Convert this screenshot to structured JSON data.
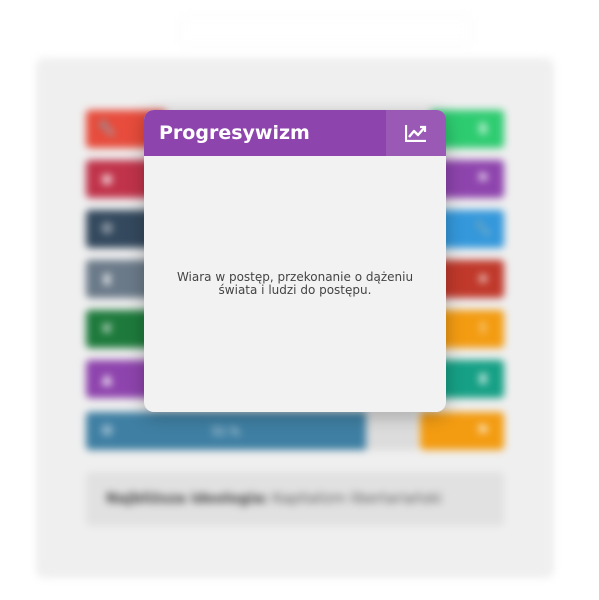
{
  "modal": {
    "title": "Progresywizm",
    "icon": "chart-line-icon",
    "description": "Wiara w postęp, przekonanie o dążeniu świata i ludzi do postępu."
  },
  "background": {
    "left_tiles": [
      {
        "icon": "wrench-icon",
        "color": "#e74c3c"
      },
      {
        "icon": "globe-icon",
        "color": "#c0334a"
      },
      {
        "icon": "gear-icon",
        "color": "#34495e"
      },
      {
        "icon": "document-icon",
        "color": "#6b7a89"
      },
      {
        "icon": "leaf-icon",
        "color": "#1e7a3c"
      },
      {
        "icon": "chart-icon",
        "color": "#8e44ad"
      }
    ],
    "right_tiles": [
      {
        "icon": "dollar-icon",
        "color": "#2ecc71"
      },
      {
        "icon": "flag-icon",
        "color": "#8e44ad"
      },
      {
        "icon": "wrench-icon",
        "color": "#3498db"
      },
      {
        "icon": "star-icon",
        "color": "#c0392b"
      },
      {
        "icon": "exclamation-icon",
        "color": "#f39c12"
      },
      {
        "icon": "hourglass-icon",
        "color": "#16a085"
      },
      {
        "icon": "flag-icon",
        "color": "#f39c12"
      }
    ],
    "wide_bar": {
      "icon": "gear-icon",
      "color": "#3f7fa3",
      "value_label": "51 %"
    },
    "nearest_label": "Najbliższa ideologia:",
    "nearest_value": "Kapitalizm libertariański"
  }
}
